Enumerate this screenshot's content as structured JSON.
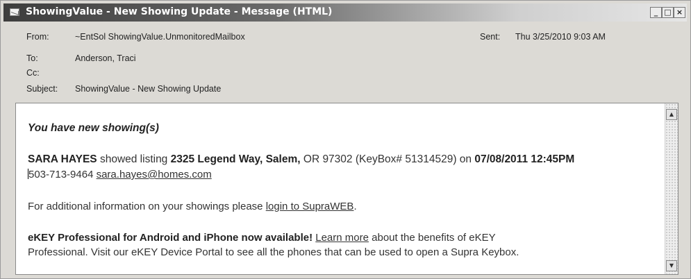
{
  "window": {
    "title": "ShowingValue - New Showing Update - Message (HTML)",
    "controls": {
      "minimize": "_",
      "maximize": "□",
      "close": "×"
    }
  },
  "header": {
    "from_label": "From:",
    "from_value": "~EntSol ShowingValue.UnmonitoredMailbox",
    "sent_label": "Sent:",
    "sent_value": "Thu 3/25/2010 9:03 AM",
    "to_label": "To:",
    "to_value": "Anderson, Traci",
    "cc_label": "Cc:",
    "cc_value": "",
    "subject_label": "Subject:",
    "subject_value": "ShowingValue - New Showing Update"
  },
  "message": {
    "heading": "You have new showing(s)",
    "showing": {
      "agent_name": "SARA HAYES",
      "showed_listing_text": " showed listing ",
      "address_street": "2325 Legend Way",
      "address_city": ", Salem,",
      "address_state_zip": " OR 97302",
      "keybox_text": " (KeyBox# 51314529) on ",
      "datetime": "07/08/2011 12:45PM",
      "phone": "503-713-9464",
      "email": "sara.hayes@homes.com"
    },
    "info_text": "For additional information on your showings please ",
    "info_link": "login to SupraWEB",
    "info_end": ".",
    "promo_bold": "eKEY Professional for Android and iPhone now available!",
    "promo_space": " ",
    "promo_link": "Learn more",
    "promo_rest": " about the benefits of eKEY",
    "promo_line2": "Professional. Visit our eKEY Device Portal to see all the phones that can be used to open a Supra Keybox."
  },
  "scrollbar": {
    "up_icon": "▲",
    "down_icon": "▼"
  }
}
